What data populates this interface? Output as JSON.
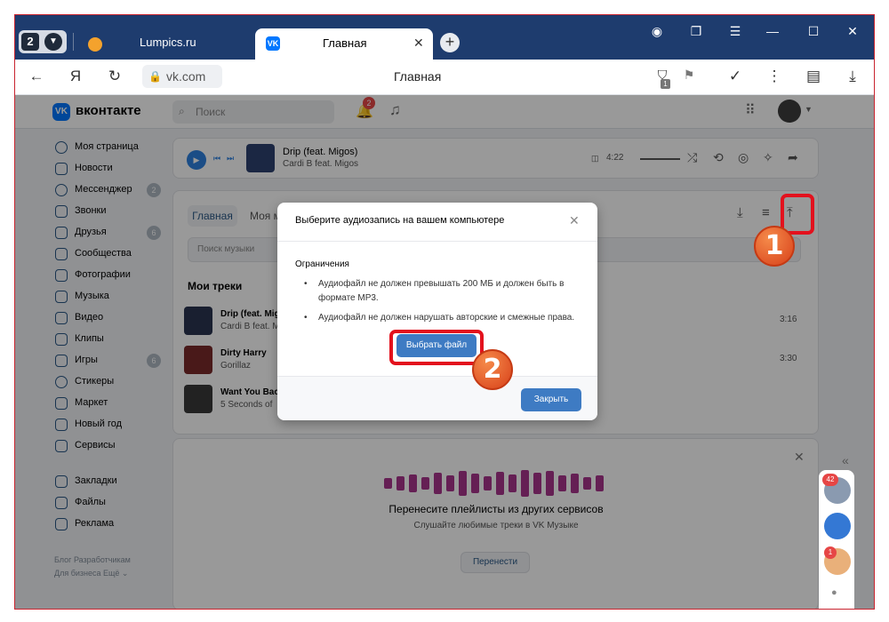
{
  "browser": {
    "tab_count": "2",
    "tabs": [
      {
        "label": "Lumpics.ru"
      },
      {
        "label": "Главная"
      }
    ],
    "url": "vk.com",
    "page_title": "Главная",
    "shield_badge": "1"
  },
  "vk": {
    "logo_text": "вконтакте",
    "search_placeholder": "Поиск",
    "bell_badge": "2",
    "sidebar": [
      {
        "label": "Моя страница",
        "count": ""
      },
      {
        "label": "Новости",
        "count": ""
      },
      {
        "label": "Мессенджер",
        "count": "2"
      },
      {
        "label": "Звонки",
        "count": ""
      },
      {
        "label": "Друзья",
        "count": "6"
      },
      {
        "label": "Сообщества",
        "count": ""
      },
      {
        "label": "Фотографии",
        "count": ""
      },
      {
        "label": "Музыка",
        "count": ""
      },
      {
        "label": "Видео",
        "count": ""
      },
      {
        "label": "Клипы",
        "count": ""
      },
      {
        "label": "Игры",
        "count": "6"
      },
      {
        "label": "Стикеры",
        "count": ""
      },
      {
        "label": "Маркет",
        "count": ""
      },
      {
        "label": "Новый год",
        "count": ""
      },
      {
        "label": "Сервисы",
        "count": ""
      },
      {
        "label": "Закладки",
        "count": ""
      },
      {
        "label": "Файлы",
        "count": ""
      },
      {
        "label": "Реклама",
        "count": ""
      }
    ],
    "footer_line1": "Блог  Разработчикам",
    "footer_line2": "Для бизнеса  Ещё ⌄"
  },
  "player": {
    "title": "Drip (feat. Migos)",
    "artist": "Cardi B feat. Migos",
    "time": "4:22"
  },
  "music": {
    "tab_active": "Главная",
    "tab_other": "Моя м",
    "search_placeholder": "Поиск музыки",
    "heading": "Мои треки",
    "tracks": [
      {
        "name": "Drip (feat. Mig",
        "artist": "Cardi B feat. M",
        "duration": "3:16"
      },
      {
        "name": "Dirty Harry",
        "artist": "Gorillaz",
        "duration": "3:30"
      },
      {
        "name": "Want You Bac",
        "artist": "5 Seconds of",
        "duration": ""
      }
    ]
  },
  "transfer": {
    "title": "Перенесите плейлисты из других сервисов",
    "subtitle": "Слушайте любимые треки в VK Музыке",
    "button": "Перенести"
  },
  "modal": {
    "title": "Выберите аудиозапись на вашем компьютере",
    "subtitle": "Ограничения",
    "items": [
      "Аудиофайл не должен превышать 200 МБ и должен быть в формате MP3.",
      "Аудиофайл не должен нарушать авторские и смежные права."
    ],
    "choose_button": "Выбрать файл",
    "close_button": "Закрыть"
  },
  "markers": [
    "1",
    "2"
  ],
  "right_panel": {
    "badge1": "42",
    "badge2": "1"
  },
  "colors": {
    "accent": "#0077ff",
    "button": "#3e7bc3",
    "highlight": "#e3111d",
    "marker": "#e05a24"
  }
}
